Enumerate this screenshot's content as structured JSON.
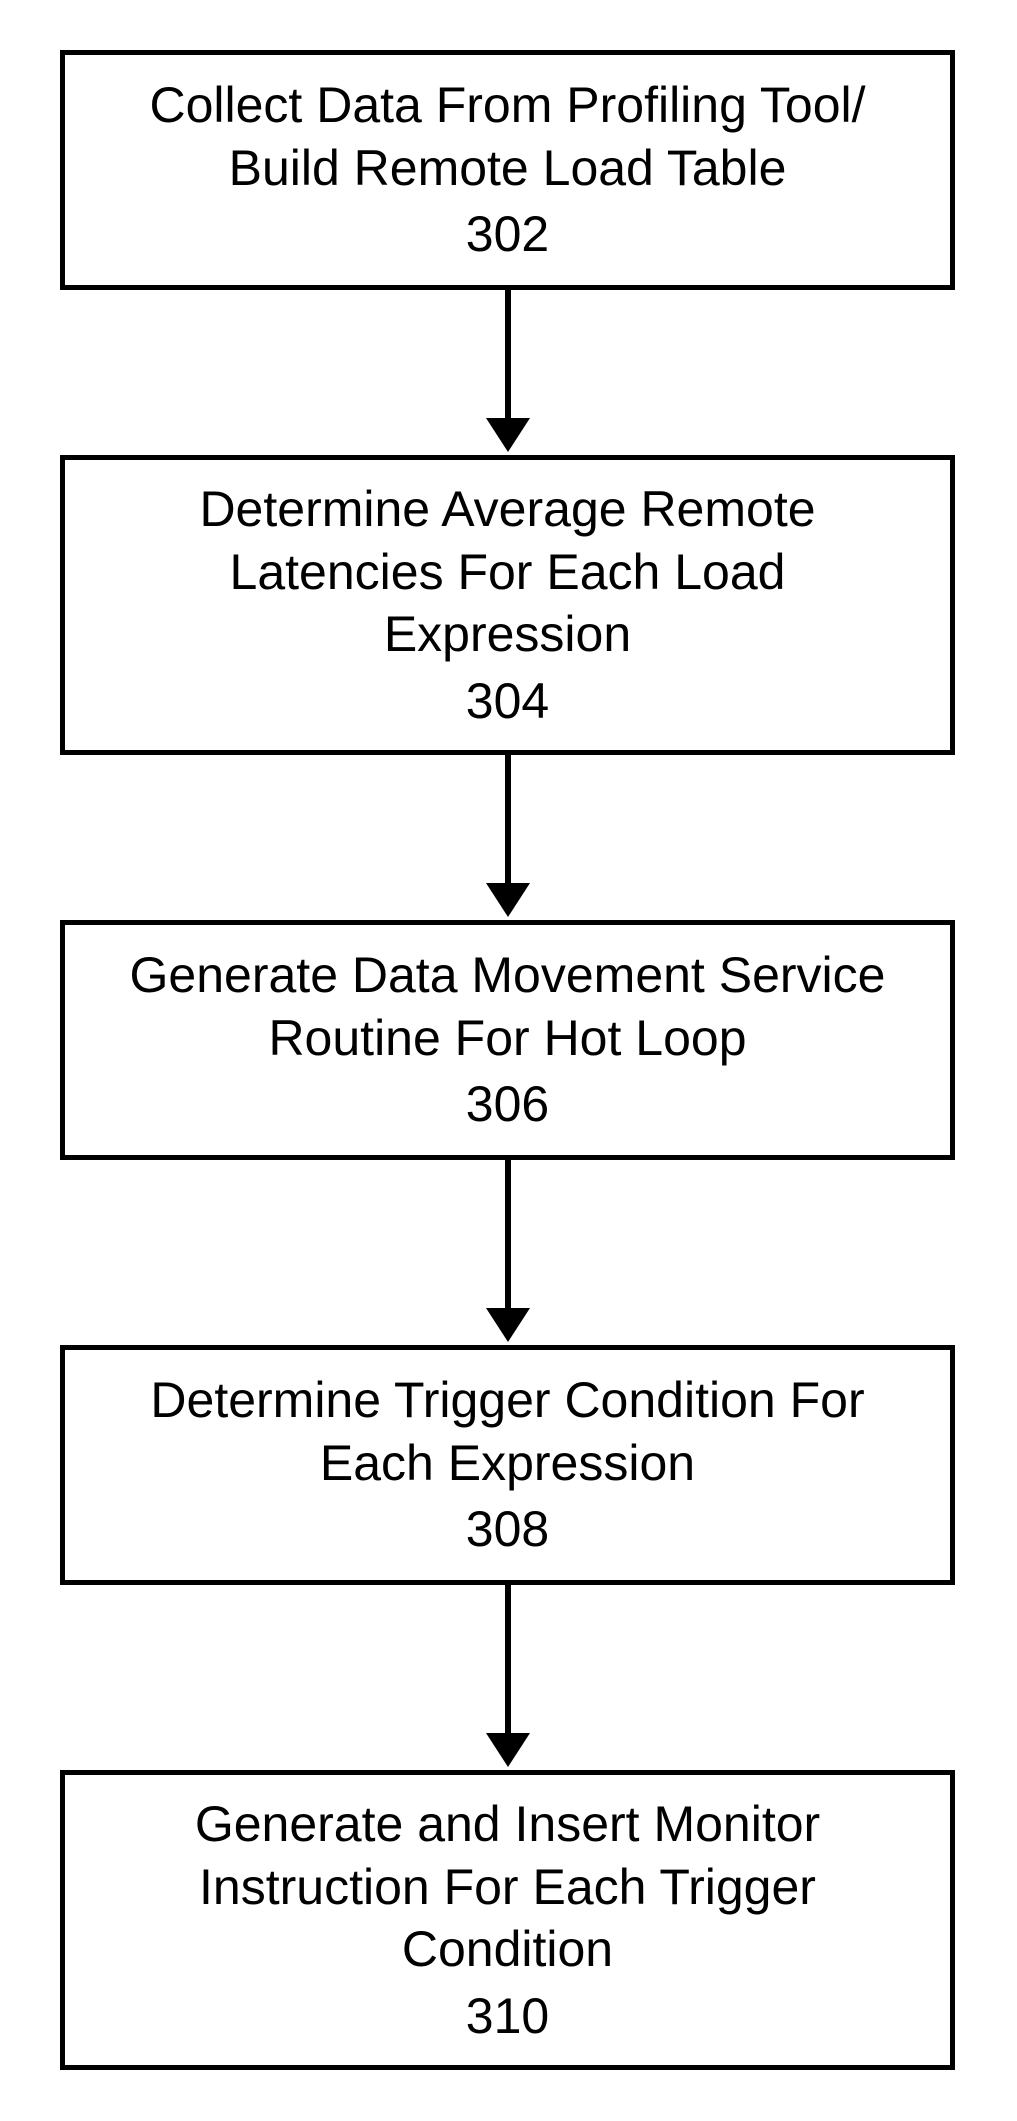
{
  "diagram": {
    "type": "flowchart",
    "direction": "top-to-bottom",
    "steps": [
      {
        "text": "Collect Data From Profiling Tool/\nBuild Remote Load Table",
        "num": "302"
      },
      {
        "text": "Determine Average Remote\nLatencies For Each Load\nExpression",
        "num": "304"
      },
      {
        "text": "Generate Data Movement Service\nRoutine For Hot Loop",
        "num": "306"
      },
      {
        "text": "Determine Trigger Condition For\nEach Expression",
        "num": "308"
      },
      {
        "text": "Generate and Insert Monitor\nInstruction For Each Trigger\nCondition",
        "num": "310"
      }
    ]
  }
}
